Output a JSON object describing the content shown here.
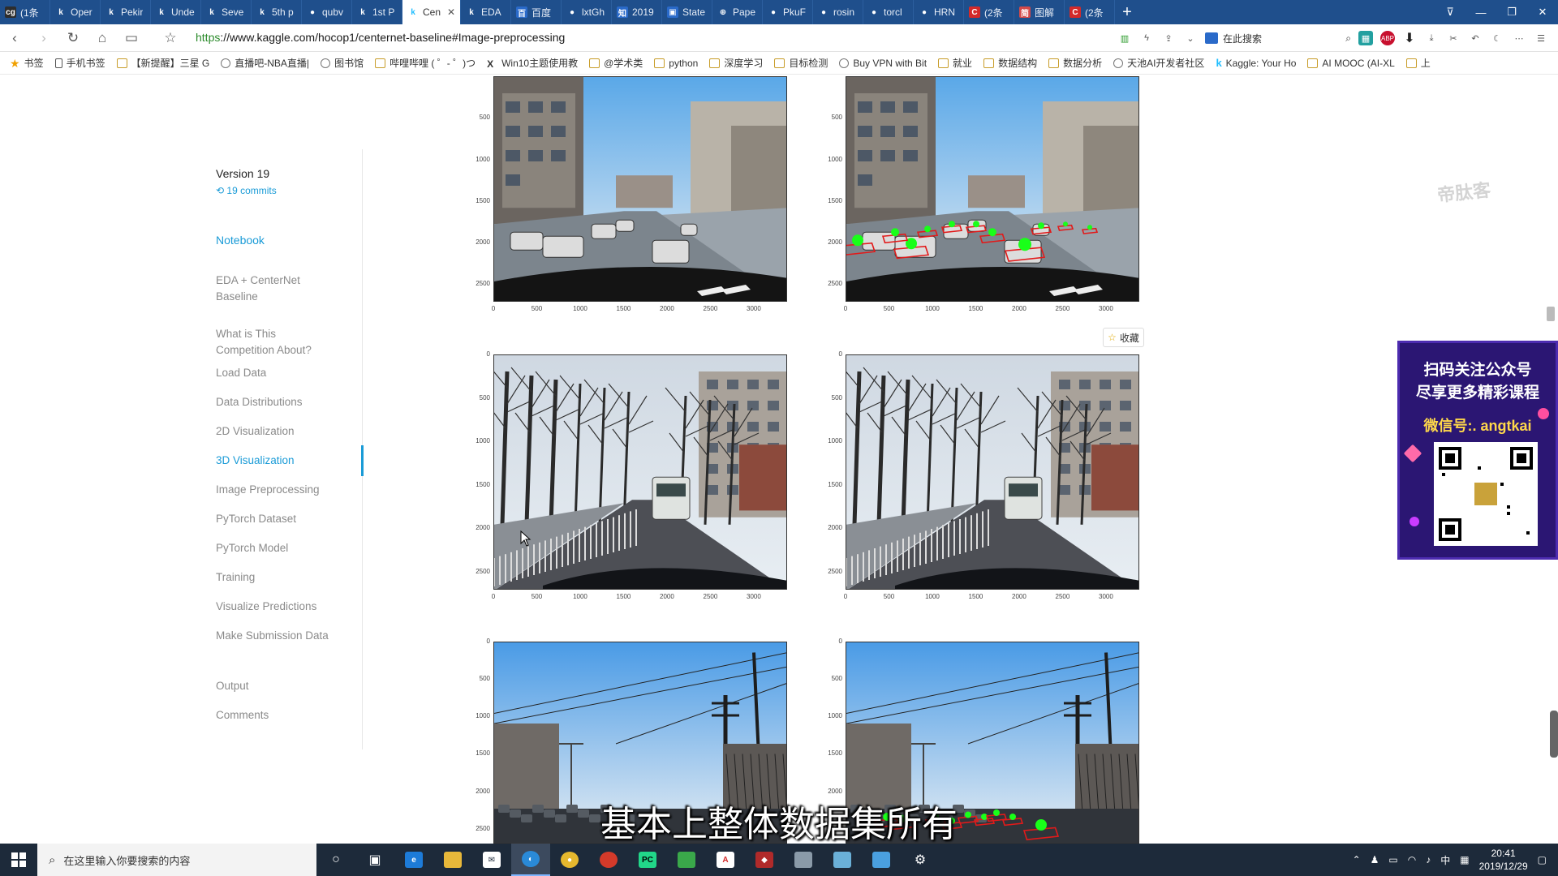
{
  "browser": {
    "tabs": [
      {
        "title": "(1条",
        "favicon": "cg",
        "color": "#2d2d2d"
      },
      {
        "title": "Oper",
        "favicon": "k",
        "color": "#1f4f8c"
      },
      {
        "title": "Pekir",
        "favicon": "k",
        "color": "#1f4f8c"
      },
      {
        "title": "Unde",
        "favicon": "k",
        "color": "#1f4f8c"
      },
      {
        "title": "Seve",
        "favicon": "k",
        "color": "#1f4f8c"
      },
      {
        "title": "5th p",
        "favicon": "k",
        "color": "#1f4f8c"
      },
      {
        "title": "qubv",
        "favicon": "gh",
        "color": "#1f4f8c"
      },
      {
        "title": "1st P",
        "favicon": "k",
        "color": "#1f4f8c"
      },
      {
        "title": "Cen",
        "favicon": "k",
        "color": "#1f4f8c",
        "active": true
      },
      {
        "title": "EDA",
        "favicon": "k",
        "color": "#1f4f8c"
      },
      {
        "title": "百度",
        "favicon": "百",
        "color": "#2a6ac9"
      },
      {
        "title": "lxtGh",
        "favicon": "gh",
        "color": "#1f4f8c"
      },
      {
        "title": "2019",
        "favicon": "知",
        "color": "#2a6ac9"
      },
      {
        "title": "State",
        "favicon": "▣",
        "color": "#2a6ac9"
      },
      {
        "title": "Pape",
        "favicon": "⊕",
        "color": "#1f4f8c"
      },
      {
        "title": "PkuF",
        "favicon": "gh",
        "color": "#1f4f8c"
      },
      {
        "title": "rosin",
        "favicon": "gh",
        "color": "#1f4f8c"
      },
      {
        "title": "torcl",
        "favicon": "gh",
        "color": "#1f4f8c"
      },
      {
        "title": "HRN",
        "favicon": "gh",
        "color": "#1f4f8c"
      },
      {
        "title": "(2条",
        "favicon": "C",
        "color": "#d42a2a"
      },
      {
        "title": "图解",
        "favicon": "简",
        "color": "#d44a4a"
      },
      {
        "title": "(2条",
        "favicon": "C",
        "color": "#d42a2a"
      }
    ],
    "new_tab": "+",
    "url_scheme": "https",
    "url_rest": "://www.kaggle.com/hocop1/centernet-baseline#Image-preprocessing",
    "search_box_label": "在此搜索",
    "bookmarks": [
      {
        "label": "书签",
        "icon": "star"
      },
      {
        "label": "手机书签",
        "icon": "phone"
      },
      {
        "label": "【新提醒】三星 G",
        "icon": "folder"
      },
      {
        "label": "直播吧-NBA直播|",
        "icon": "glob"
      },
      {
        "label": "图书馆",
        "icon": "glob"
      },
      {
        "label": "哔哩哔哩 ( ゜- ゜)つ",
        "icon": "folder"
      },
      {
        "label": "Win10主题使用教",
        "icon": "x"
      },
      {
        "label": "@学术类",
        "icon": "folder"
      },
      {
        "label": "python",
        "icon": "folder"
      },
      {
        "label": "深度学习",
        "icon": "folder"
      },
      {
        "label": "目标检测",
        "icon": "folder"
      },
      {
        "label": "Buy VPN with Bit",
        "icon": "glob"
      },
      {
        "label": "就业",
        "icon": "folder"
      },
      {
        "label": "数据结构",
        "icon": "folder"
      },
      {
        "label": "数据分析",
        "icon": "folder"
      },
      {
        "label": "天池AI开发者社区",
        "icon": "glob"
      },
      {
        "label": "Kaggle: Your Ho",
        "icon": "kg"
      },
      {
        "label": "AI MOOC (AI-XL",
        "icon": "folder"
      },
      {
        "label": "上",
        "icon": "folder"
      }
    ]
  },
  "sidebar": {
    "version": "Version 19",
    "commits": "19 commits",
    "notebook": "Notebook",
    "items": [
      {
        "label": "EDA + CenterNet Baseline",
        "active": false
      },
      {
        "label": "What is This Competition About?",
        "active": false
      },
      {
        "label": "Load Data",
        "active": false
      },
      {
        "label": "Data Distributions",
        "active": false
      },
      {
        "label": "2D Visualization",
        "active": false
      },
      {
        "label": "3D Visualization",
        "active": true
      },
      {
        "label": "Image Preprocessing",
        "active": false
      },
      {
        "label": "PyTorch Dataset",
        "active": false
      },
      {
        "label": "PyTorch Model",
        "active": false
      },
      {
        "label": "Training",
        "active": false
      },
      {
        "label": "Visualize Predictions",
        "active": false
      },
      {
        "label": "Make Submission Data",
        "active": false
      },
      {
        "label": "Output",
        "active": false
      },
      {
        "label": "Comments",
        "active": false
      }
    ]
  },
  "plots": {
    "yticks": [
      "0",
      "500",
      "1000",
      "1500",
      "2000",
      "2500"
    ],
    "xticks": [
      "0",
      "500",
      "1000",
      "1500",
      "2000",
      "2500",
      "3000"
    ]
  },
  "favorite_button": "收藏",
  "watermark": "帝肽客",
  "ad": {
    "line1": "扫码关注公众号",
    "line2": "尽享更多精彩课程",
    "line3": "微信号:. angtkai"
  },
  "subtitle": "基本上整体数据集所有",
  "taskbar": {
    "search_placeholder": "在这里输入你要搜索的内容",
    "time": "20:41",
    "date": "2019/12/29",
    "ime": "中"
  }
}
